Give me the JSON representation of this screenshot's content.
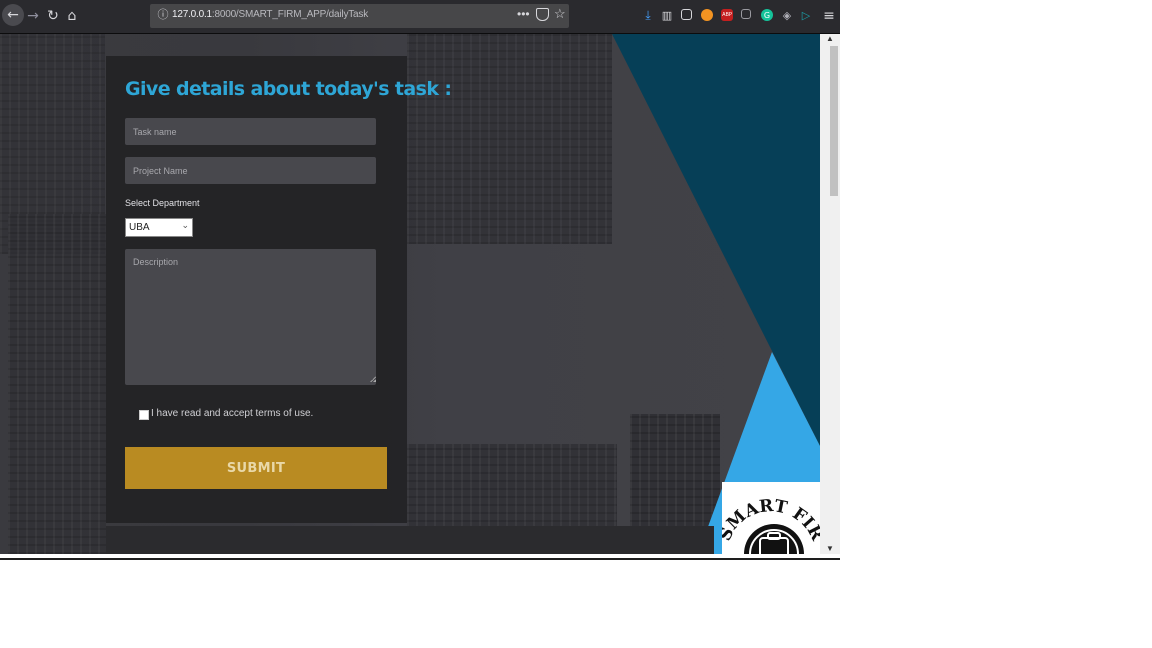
{
  "browser": {
    "url_host": "127.0.0.1",
    "url_rest": ":8000/SMART_FIRM_APP/dailyTask",
    "menu_dots": "•••",
    "menu_label": "≡",
    "extensions": [
      "download-icon",
      "library-icon",
      "sidebar-icon",
      "ext-orange-icon",
      "abp-icon",
      "ext-square-icon",
      "grammarly-icon",
      "ext-diamond-icon",
      "ext-arrow-icon"
    ],
    "abp_text": "ABP",
    "grammarly_text": "G"
  },
  "form": {
    "title": "Give details about today's task :",
    "task_name_placeholder": "Task name",
    "project_name_placeholder": "Project Name",
    "department_label": "Select Department",
    "department_value": "UBA",
    "description_placeholder": "Description",
    "terms_label": "I have read and accept terms of use.",
    "terms_checked": false,
    "submit_label": "SUBMIT"
  },
  "logo": {
    "text": "SMART FIRM"
  },
  "colors": {
    "title": "#2ea6d6",
    "submit": "#b98b22",
    "teal_panel": "#063f57",
    "light_blue_triangle": "#35a7e6"
  }
}
